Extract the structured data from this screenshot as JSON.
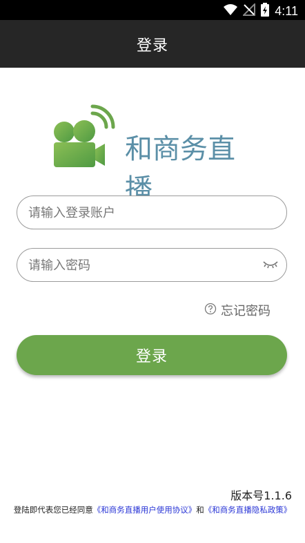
{
  "status_bar": {
    "time": "4:11",
    "icons": [
      "wifi-icon",
      "no-signal-icon",
      "battery-charging-icon"
    ]
  },
  "header": {
    "title": "登录"
  },
  "logo": {
    "icon": "video-camera-broadcast-icon",
    "text": "和商务直播",
    "colors": {
      "camera": "#6ca64c",
      "text": "#5b8fa7"
    }
  },
  "form": {
    "account": {
      "placeholder": "请输入登录账户",
      "value": ""
    },
    "password": {
      "placeholder": "请输入密码",
      "value": "",
      "toggle_icon": "eye-closed-icon"
    },
    "forgot": {
      "icon": "question-circle-icon",
      "label": "忘记密码"
    },
    "submit_label": "登录"
  },
  "footer": {
    "version": "版本号1.1.6",
    "agreement_prefix": "登陆即代表您已经同意",
    "user_agreement": "《和商务直播用户使用协议》",
    "connector": "和",
    "privacy_policy": "《和商务直播隐私政策》"
  },
  "colors": {
    "accent": "#6ca64c",
    "header_bg": "#262626",
    "link": "#2a36d6"
  }
}
